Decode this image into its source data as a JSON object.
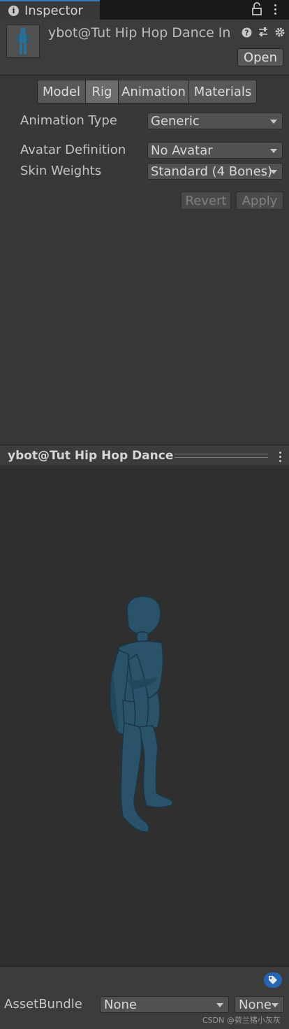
{
  "tab": {
    "title": "Inspector",
    "info_icon": "info-icon",
    "lock_icon": "lock-icon",
    "menu_icon": "kebab-menu-icon"
  },
  "asset": {
    "name": "ybot@Tut Hip Hop Dance In",
    "help_icon": "help-icon",
    "presets_icon": "presets-icon",
    "settings_icon": "gear-icon",
    "open_label": "Open"
  },
  "subtabs": [
    {
      "label": "Model",
      "active": false
    },
    {
      "label": "Rig",
      "active": true
    },
    {
      "label": "Animation",
      "active": false
    },
    {
      "label": "Materials",
      "active": false
    }
  ],
  "fields": {
    "animation_type": {
      "label": "Animation Type",
      "value": "Generic"
    },
    "avatar_definition": {
      "label": "Avatar Definition",
      "value": "No Avatar"
    },
    "skin_weights": {
      "label": "Skin Weights",
      "value": "Standard (4 Bones)"
    }
  },
  "actions": {
    "revert_label": "Revert",
    "apply_label": "Apply"
  },
  "preview": {
    "title": "ybot@Tut Hip Hop Dance",
    "model_color": "#2a5268"
  },
  "footer": {
    "assetbundle_label": "AssetBundle",
    "bundle_value": "None",
    "variant_value": "None",
    "watermark": "CSDN @荷兰猪小灰灰"
  },
  "colors": {
    "accent": "#3a79bb",
    "tag_blue": "#2566b3",
    "panel": "#383838"
  }
}
